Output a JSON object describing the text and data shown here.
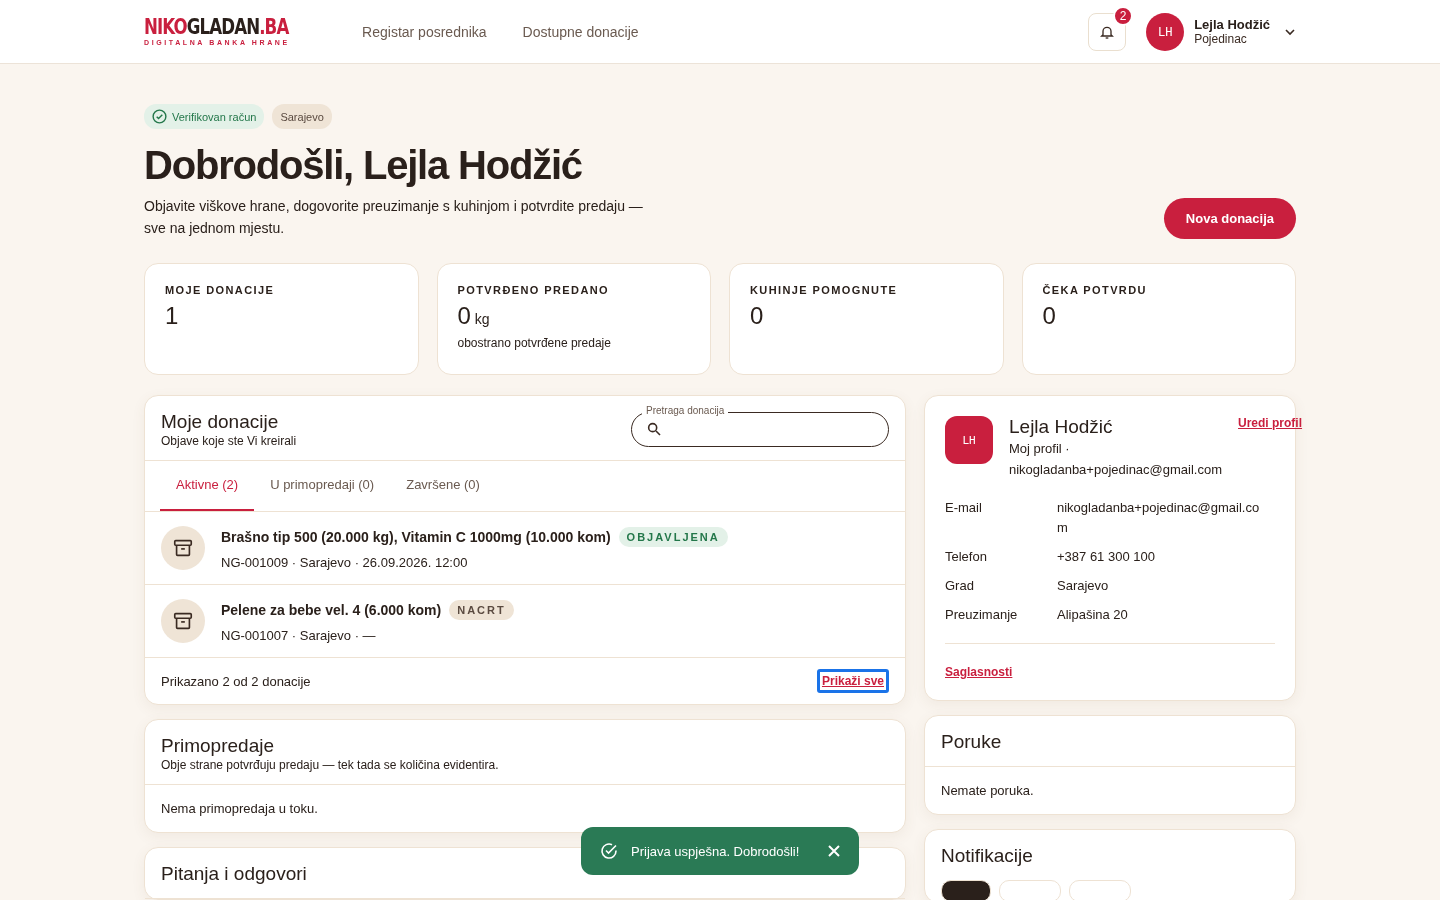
{
  "header": {
    "logo": [
      {
        "text": "NIKO",
        "accent": true
      },
      {
        "text": "GLADAN",
        "accent": false
      },
      {
        "text": ".BA",
        "accent": true
      }
    ],
    "tagline": "DIGITALNA BANKA HRANE",
    "nav": [
      "Registar posrednika",
      "Dostupne donacije"
    ],
    "notification_count": "2",
    "user": {
      "initials": "LH",
      "name": "Lejla Hodžić",
      "role": "Pojedinac"
    }
  },
  "hero": {
    "badges": [
      {
        "label": "Verifikovan račun",
        "kind": "verified"
      },
      {
        "label": "Sarajevo",
        "kind": "plain"
      }
    ],
    "title": "Dobrodošli, Lejla Hodžić",
    "subtitle": "Objavite viškove hrane, dogovorite preuzimanje s kuhinjom i potvrdite predaju — sve na jednom mjestu.",
    "button": "Nova donacija"
  },
  "stats": [
    {
      "label": "MOJE DONACIJE",
      "value": "1"
    },
    {
      "label": "POTVRĐENO PREDANO",
      "value": "0",
      "unit": "kg",
      "note": "obostrano potvrđene predaje"
    },
    {
      "label": "KUHINJE POMOGNUTE",
      "value": "0"
    },
    {
      "label": "ČEKA POTVRDU",
      "value": "0"
    }
  ],
  "donations": {
    "title": "Moje donacije",
    "subtitle": "Objave koje ste Vi kreirali",
    "search_label": "Pretraga donacija",
    "tabs": [
      {
        "label": "Aktivne (2)",
        "selected": true
      },
      {
        "label": "U primopredaji (0)",
        "selected": false
      },
      {
        "label": "Završene (0)",
        "selected": false
      }
    ],
    "items": [
      {
        "title": "Brašno tip 500 (20.000 kg), Vitamin C 1000mg (10.000 kom)",
        "status": "OBJAVLJENA",
        "kind": "published",
        "meta": "NG-001009 · Sarajevo · 26.09.2026. 12:00"
      },
      {
        "title": "Pelene za bebe vel. 4 (6.000 kom)",
        "status": "NACRT",
        "kind": "draft",
        "meta": "NG-001007 · Sarajevo · —"
      }
    ],
    "footer": "Prikazano 2 od 2 donacije",
    "show_all": {
      "label": "Prikaži sve",
      "focused": true
    }
  },
  "handovers": {
    "title": "Primopredaje",
    "subtitle": "Obje strane potvrđuju predaju — tek tada se količina evidentira.",
    "empty": "Nema primopredaja u toku."
  },
  "qa": {
    "title": "Pitanja i odgovori"
  },
  "profile": {
    "initials": "LH",
    "name": "Lejla Hodžić",
    "subtitle": "Moj profil ·",
    "email": "nikogladanba+pojedinac@gmail.com",
    "edit": "Uredi profil",
    "fields": [
      {
        "label": "E-mail",
        "value": "nikogladanba+pojedinac@gmail.com"
      },
      {
        "label": "Telefon",
        "value": "+387 61 300 100"
      },
      {
        "label": "Grad",
        "value": "Sarajevo"
      },
      {
        "label": "Preuzimanje",
        "value": "Alipašina 20"
      }
    ],
    "consents": "Saglasnosti"
  },
  "messages": {
    "title": "Poruke",
    "empty": "Nemate poruka."
  },
  "notifications": {
    "title": "Notifikacije"
  },
  "toast": {
    "text": "Prijava uspješna. Dobrodošli!"
  }
}
